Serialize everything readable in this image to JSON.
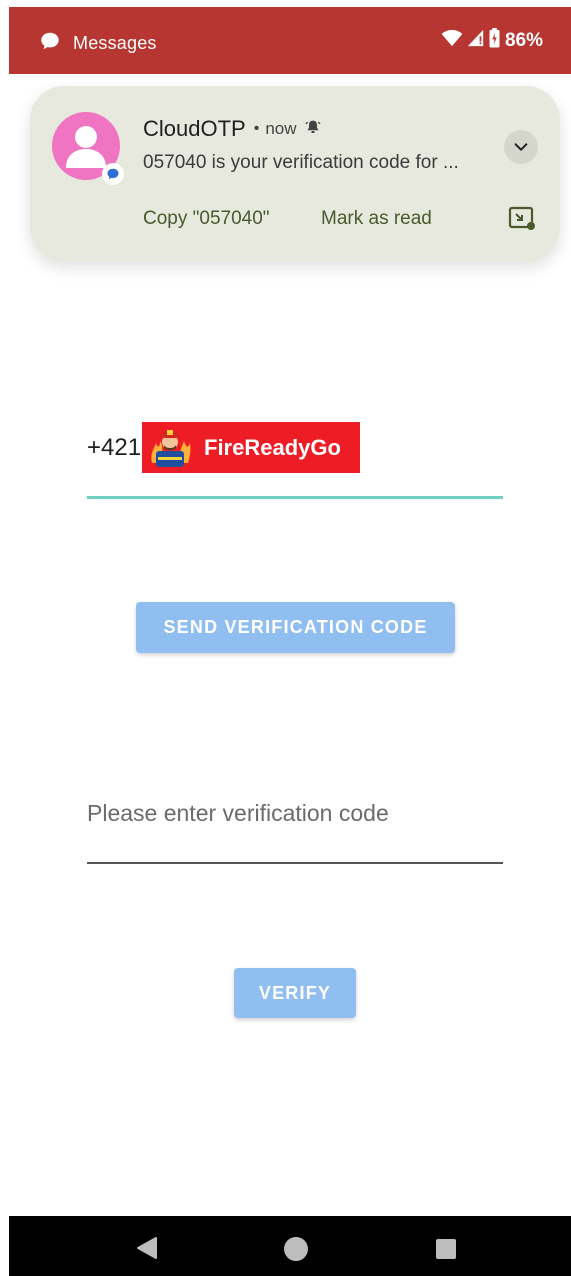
{
  "status_bar": {
    "app_label": "Messages",
    "battery_percent": "86%",
    "colors": {
      "background": "#b73631",
      "text": "#ffffff"
    },
    "icons": [
      "messages-icon",
      "wifi-icon",
      "cell-signal-icon",
      "battery-icon"
    ]
  },
  "notification": {
    "title": "CloudOTP",
    "separator": "•",
    "time": "now",
    "body": "057040 is your verification code for ...",
    "actions": {
      "copy": "Copy \"057040\"",
      "mark_read": "Mark as read"
    },
    "icons": [
      "avatar-person-icon",
      "messages-badge-icon",
      "alert-bell-icon",
      "chevron-down-icon",
      "picture-in-picture-icon"
    ],
    "colors": {
      "card": "#e7e9df",
      "action": "#4a5a2c",
      "avatar": "#ef74c1"
    }
  },
  "phone_input": {
    "prefix": "+421",
    "overlay_badge_text": "FireReadyGo",
    "colors": {
      "badge": "#ee1c25",
      "underline": "#6fd1bf"
    }
  },
  "send_button": {
    "label": "SEND VERIFICATION CODE"
  },
  "code_input": {
    "placeholder": "Please enter verification code"
  },
  "verify_button": {
    "label": "VERIFY"
  },
  "colors": {
    "button": "#90bef0"
  },
  "nav_bar": {
    "icons": [
      "back-icon",
      "home-icon",
      "recents-icon"
    ]
  }
}
